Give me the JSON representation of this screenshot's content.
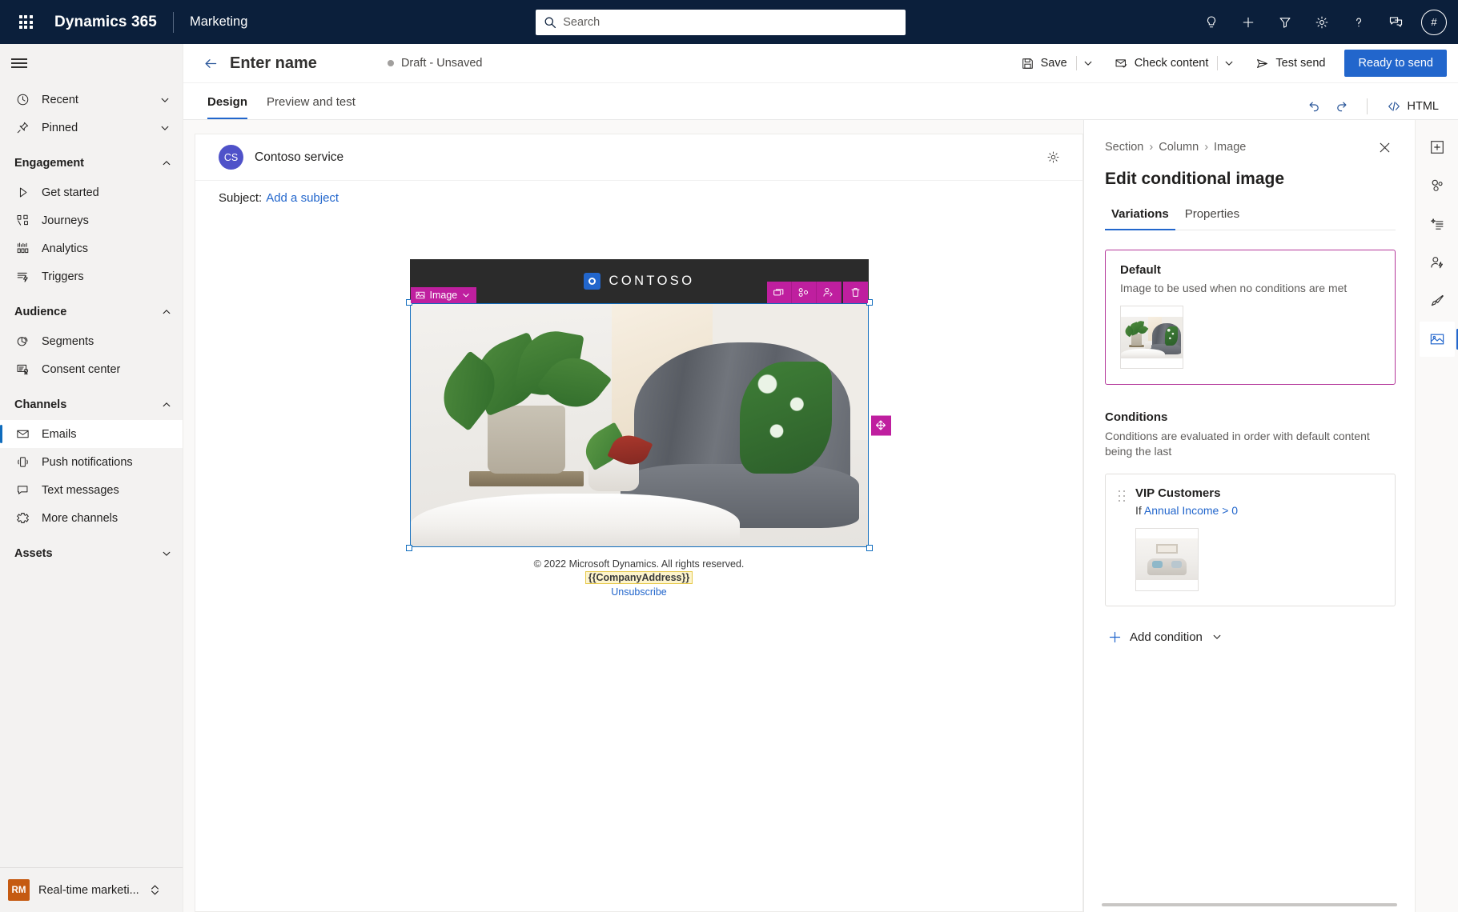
{
  "topnav": {
    "waffle_label": "App launcher",
    "brand": "Dynamics 365",
    "app_name": "Marketing",
    "search_placeholder": "Search",
    "icons": [
      {
        "name": "lightbulb-icon",
        "label": "Smart assist"
      },
      {
        "name": "plus-icon",
        "label": "Quick create"
      },
      {
        "name": "filter-icon",
        "label": "Filter"
      },
      {
        "name": "gear-icon",
        "label": "Settings"
      },
      {
        "name": "help-icon",
        "label": "Help"
      },
      {
        "name": "feedback-icon",
        "label": "Feedback"
      }
    ],
    "avatar_initials": "#"
  },
  "sidebar": {
    "hamburger_label": "Show/hide navigation pane",
    "items": [
      {
        "label": "Recent",
        "icon": "clock-icon",
        "type": "expander",
        "chevron": "down"
      },
      {
        "label": "Pinned",
        "icon": "pin-icon",
        "type": "expander",
        "chevron": "down"
      }
    ],
    "groups": [
      {
        "label": "Engagement",
        "chevron": "up",
        "items": [
          {
            "label": "Get started",
            "icon": "play-icon"
          },
          {
            "label": "Journeys",
            "icon": "journeys-icon"
          },
          {
            "label": "Analytics",
            "icon": "analytics-icon"
          },
          {
            "label": "Triggers",
            "icon": "triggers-icon"
          }
        ]
      },
      {
        "label": "Audience",
        "chevron": "up",
        "items": [
          {
            "label": "Segments",
            "icon": "segments-icon"
          },
          {
            "label": "Consent center",
            "icon": "consent-icon"
          }
        ]
      },
      {
        "label": "Channels",
        "chevron": "up",
        "items": [
          {
            "label": "Emails",
            "icon": "mail-icon",
            "selected": true
          },
          {
            "label": "Push notifications",
            "icon": "push-icon"
          },
          {
            "label": "Text messages",
            "icon": "sms-icon"
          },
          {
            "label": "More channels",
            "icon": "more-channels-icon"
          }
        ]
      },
      {
        "label": "Assets",
        "chevron": "down",
        "items": []
      }
    ],
    "area_switcher": {
      "badge": "RM",
      "label": "Real-time marketi..."
    }
  },
  "command_bar": {
    "back_label": "Back",
    "page_title": "Enter name",
    "status": "Draft - Unsaved",
    "save_label": "Save",
    "check_content_label": "Check content",
    "test_send_label": "Test send",
    "primary_label": "Ready to send"
  },
  "tabs": {
    "items": [
      {
        "label": "Design",
        "active": true
      },
      {
        "label": "Preview and test",
        "active": false
      }
    ],
    "undo_label": "Undo",
    "redo_label": "Redo",
    "html_label": "HTML"
  },
  "email": {
    "sender_initials": "CS",
    "sender_name": "Contoso service",
    "settings_label": "Email settings",
    "subject_label": "Subject:",
    "subject_link": "Add a subject",
    "brand_word": "CONTOSO",
    "element_tag": "Image",
    "element_tools": [
      {
        "name": "duplicate-icon",
        "label": "Duplicate"
      },
      {
        "name": "conditional-content-icon",
        "label": "Conditional content"
      },
      {
        "name": "personalize-icon",
        "label": "Personalize"
      },
      {
        "name": "delete-icon",
        "label": "Delete"
      }
    ],
    "drag_label": "Move element",
    "footer_copyright": "© 2022 Microsoft Dynamics. All rights reserved.",
    "footer_token": "{{CompanyAddress}}",
    "footer_unsubscribe": "Unsubscribe"
  },
  "right_panel": {
    "breadcrumb": [
      "Section",
      "Column",
      "Image"
    ],
    "close_label": "Close",
    "title": "Edit conditional image",
    "tabs": [
      {
        "label": "Variations",
        "active": true
      },
      {
        "label": "Properties",
        "active": false
      }
    ],
    "default_variation": {
      "title": "Default",
      "description": "Image to be used when no conditions are met",
      "thumb_label": "Default image thumbnail"
    },
    "conditions_heading": "Conditions",
    "conditions_description": "Conditions are evaluated in order with default content being the last",
    "conditions": [
      {
        "name": "VIP Customers",
        "rule_prefix": "If",
        "rule_field": "Annual Income",
        "rule_operator": "> 0",
        "thumb_label": "VIP Customers image thumbnail"
      }
    ],
    "add_condition_label": "Add condition"
  },
  "tool_strip": {
    "tools": [
      {
        "name": "add-element-icon",
        "label": "Elements",
        "active": false
      },
      {
        "name": "components-icon",
        "label": "Components",
        "active": false
      },
      {
        "name": "dynamic-text-icon",
        "label": "Dynamic text",
        "active": false
      },
      {
        "name": "personalization-icon",
        "label": "Personalization",
        "active": false
      },
      {
        "name": "styles-brush-icon",
        "label": "Styles",
        "active": false
      },
      {
        "name": "image-icon",
        "label": "Image",
        "active": true
      }
    ]
  },
  "colors": {
    "nav_background": "#0b1f3b",
    "accent_blue": "#2266cc",
    "element_magenta": "#bf1f9f",
    "variation_border": "#b4379a",
    "area_badge": "#c55a11"
  }
}
